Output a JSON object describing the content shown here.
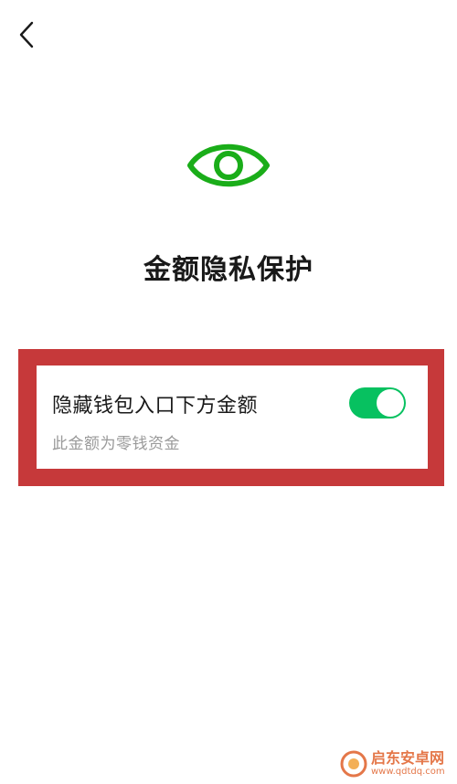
{
  "header": {
    "back_icon": "chevron-left-icon"
  },
  "hero": {
    "icon": "eye-icon",
    "title": "金额隐私保护"
  },
  "setting": {
    "title": "隐藏钱包入口下方金额",
    "description": "此金额为零钱资金",
    "toggle_on": true
  },
  "watermark": {
    "name": "启东安卓网",
    "url": "www.qdtdq.com"
  },
  "colors": {
    "accent_green": "#07c160",
    "eye_green": "#1aad19",
    "highlight_red": "#c6393a",
    "watermark_orange": "#e0602a"
  }
}
